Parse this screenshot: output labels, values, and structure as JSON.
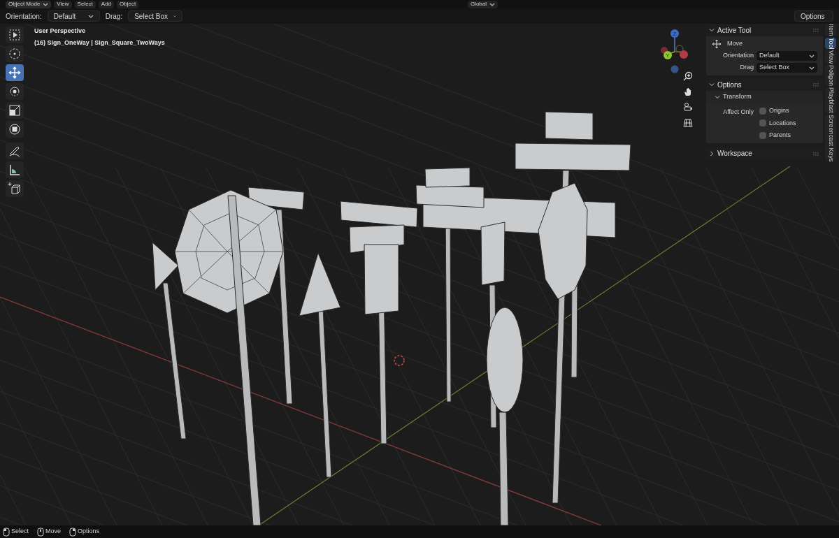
{
  "header": {
    "mode": "Object Mode",
    "menus": [
      "View",
      "Select",
      "Add",
      "Object"
    ],
    "transform_orientation": "Global"
  },
  "tool_settings": {
    "orientation_label": "Orientation:",
    "orientation": "Default",
    "drag_label": "Drag:",
    "drag": "Select Box",
    "options": "Options"
  },
  "toolbar": [
    {
      "kind": "select_box",
      "selected": false
    },
    {
      "kind": "cursor",
      "selected": false
    },
    {
      "kind": "move",
      "selected": true
    },
    {
      "kind": "rotate",
      "selected": false
    },
    {
      "kind": "scale",
      "selected": false
    },
    {
      "kind": "transform",
      "selected": false
    },
    {
      "kind": "annotate",
      "selected": false
    },
    {
      "kind": "measure",
      "selected": false
    },
    {
      "kind": "add_cube",
      "selected": false
    }
  ],
  "viewport": {
    "overlay_lines": [
      "User Perspective",
      "(16) Sign_OneWay | Sign_Square_TwoWays"
    ],
    "gizmo_labels": [
      "Z",
      "Y"
    ]
  },
  "sidebar": {
    "tabs": [
      {
        "label": "Item",
        "selected": false
      },
      {
        "label": "Tool",
        "selected": true
      },
      {
        "label": "View",
        "selected": false
      },
      {
        "label": "Poligon",
        "selected": false
      },
      {
        "label": "Playblast",
        "selected": false
      },
      {
        "label": "Screencast Keys",
        "selected": false
      }
    ],
    "active_tool": {
      "title": "Active Tool",
      "expanded": true,
      "tool": "Move",
      "orientation_label": "Orientation",
      "orientation": "Default",
      "drag_label": "Drag",
      "drag": "Select Box"
    },
    "options": {
      "title": "Options",
      "expanded": true,
      "transform": {
        "title": "Transform",
        "expanded": true,
        "affect_label": "Affect Only",
        "checkboxes": [
          {
            "label": "Origins",
            "checked": false
          },
          {
            "label": "Locations",
            "checked": false
          },
          {
            "label": "Parents",
            "checked": false
          }
        ]
      }
    },
    "workspace": {
      "title": "Workspace",
      "expanded": false
    }
  },
  "status_bar": [
    {
      "label": "Select",
      "kind": "left"
    },
    {
      "label": "Move",
      "kind": "middle"
    },
    {
      "label": "Options",
      "kind": "right"
    }
  ]
}
